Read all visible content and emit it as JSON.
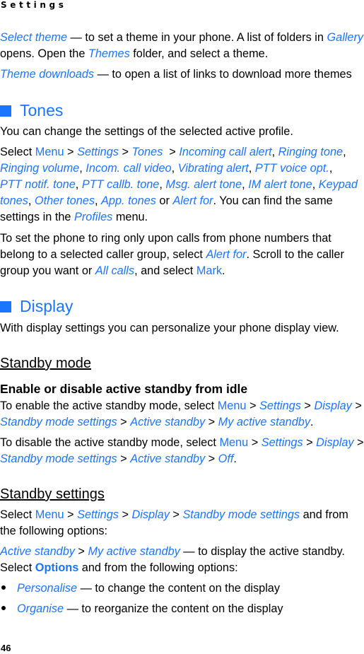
{
  "header": {
    "title": "Settings"
  },
  "colors": {
    "accent": "#1a75ff",
    "text": "#000000"
  },
  "themes": {
    "select_theme": {
      "term": "Select theme",
      "text_a": " — to set a theme in your phone. A list of folders in ",
      "gallery": "Gallery",
      "text_b": "opens. Open the ",
      "themes_folder": "Themes",
      "text_c": " folder, and select a theme."
    },
    "theme_downloads": {
      "term": "Theme downloads",
      "text": " — to open a list of links to download more themes"
    }
  },
  "tones": {
    "heading": "Tones",
    "intro": "You can change the settings of the selected active profile.",
    "select": "Select ",
    "menu": "Menu",
    "sep": " > ",
    "path": [
      "Settings",
      "Tones"
    ],
    "options": [
      "Incoming call alert",
      "Ringing tone",
      "Ringing volume",
      "Incom. call video",
      "Vibrating alert",
      "PTT voice opt.",
      "PTT notif. tone",
      "PTT callb. tone",
      "Msg. alert tone",
      "IM alert tone",
      "Keypad tones",
      "Other tones",
      "App. tones",
      "Alert for"
    ],
    "or": " or ",
    "tail_a": ". You can find the same",
    "tail_b": "settings in the ",
    "profiles": "Profiles",
    "tail_c": " menu.",
    "ring_line1": "To set the phone to ring only upon calls from phone numbers that",
    "ring_line2a": "belong to a selected caller group, select ",
    "alert_for": "Alert for",
    "ring_line2b": ". Scroll to the caller",
    "ring_line3a": "group you want or ",
    "all_calls": "All calls",
    "ring_line3b": ", and select ",
    "mark": "Mark",
    "period": "."
  },
  "display": {
    "heading": "Display",
    "intro": "With display settings you can personalize your phone display view.",
    "standby_mode": {
      "heading": "Standby mode",
      "subheading": "Enable or disable active standby from idle",
      "enable_a": "To enable the active standby mode, select ",
      "disable_a": "To disable the active standby mode, select ",
      "menu": "Menu",
      "settings": "Settings",
      "display": "Display",
      "standby_mode_settings": "Standby mode settings",
      "active_standby": "Active standby",
      "my_active_standby": "My active standby",
      "off": "Off"
    },
    "standby_settings": {
      "heading": "Standby settings",
      "select": "Select ",
      "menu": "Menu",
      "settings": "Settings",
      "display": "Display",
      "standby_mode_settings": "Standby mode settings",
      "and_from": " and from",
      "following": "the following options:",
      "active_standby": "Active standby",
      "my_active_standby": "My active standby",
      "to_display": " — to display the active standby.",
      "select_options_a": "Select ",
      "options": "Options",
      "select_options_b": " and from the following options:",
      "bullets": [
        {
          "term": "Personalise",
          "text": " — to change the content on the display"
        },
        {
          "term": "Organise",
          "text": " — to reorganize the content on the display"
        }
      ]
    }
  },
  "footer": {
    "page_number": "46"
  }
}
